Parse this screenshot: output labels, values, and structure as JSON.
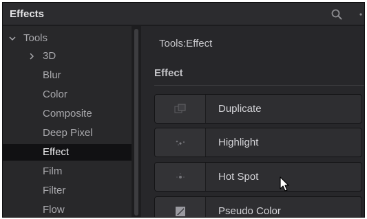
{
  "panel": {
    "title": "Effects"
  },
  "header_icons": [
    "search-icon",
    "options-icon"
  ],
  "sidebar": {
    "root": {
      "label": "Tools",
      "expanded": true
    },
    "items": [
      {
        "label": "3D",
        "collapsed_group": true
      },
      {
        "label": "Blur"
      },
      {
        "label": "Color"
      },
      {
        "label": "Composite"
      },
      {
        "label": "Deep Pixel"
      },
      {
        "label": "Effect",
        "selected": true
      },
      {
        "label": "Film"
      },
      {
        "label": "Filter"
      },
      {
        "label": "Flow"
      }
    ]
  },
  "main": {
    "breadcrumb": "Tools:Effect",
    "section_title": "Effect",
    "effects": [
      {
        "label": "Duplicate",
        "icon": "duplicate-icon"
      },
      {
        "label": "Highlight",
        "icon": "highlight-icon"
      },
      {
        "label": "Hot Spot",
        "icon": "hot-spot-icon"
      },
      {
        "label": "Pseudo Color",
        "icon": "pseudo-color-icon"
      }
    ]
  },
  "colors": {
    "window_bg": "#1f1f21",
    "selected_row": "#111113",
    "text_muted": "#a9a9ad",
    "text_bright": "#f2f2f4"
  }
}
